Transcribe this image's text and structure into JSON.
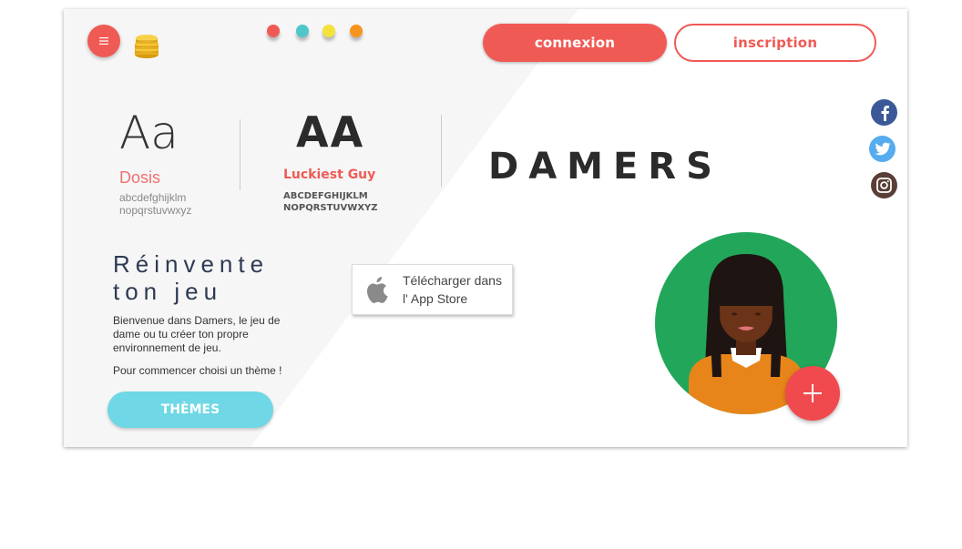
{
  "header": {
    "menu_icon": "hamburger-icon",
    "logo_icon": "coins-icon",
    "palette": [
      "#f05a55",
      "#4fc6c9",
      "#f3e23a",
      "#f7941d"
    ],
    "login_label": "connexion",
    "signup_label": "inscription"
  },
  "typography": {
    "sample1": {
      "glyph": "Aa",
      "name": "Dosis",
      "lower1": "abcdefghijklm",
      "lower2": "nopqrstuvwxyz"
    },
    "sample2": {
      "glyph": "AA",
      "name": "Luckiest Guy",
      "upper1": "ABCDEFGHIJKLM",
      "upper2": "NOPQRSTUVWXYZ"
    }
  },
  "brand": "DAMERS",
  "hero": {
    "title_line1": "Réinvente",
    "title_line2": "ton jeu",
    "description": "Bienvenue dans Damers, le jeu de dame  ou tu créer ton propre environnement de jeu.",
    "cta_text": "Pour commencer choisi un thème !",
    "themes_button": "THÈMES"
  },
  "appstore": {
    "icon": "apple-icon",
    "line1": "Télécharger dans",
    "line2": "l' App Store"
  },
  "avatar": {
    "icon": "user-avatar",
    "add_icon": "plus-icon"
  },
  "social": [
    "facebook-icon",
    "twitter-icon",
    "instagram-icon"
  ],
  "colors": {
    "accent": "#f05a55",
    "teal": "#6fd7e5",
    "avatar_bg": "#22a75a",
    "shirt": "#e8851a"
  }
}
